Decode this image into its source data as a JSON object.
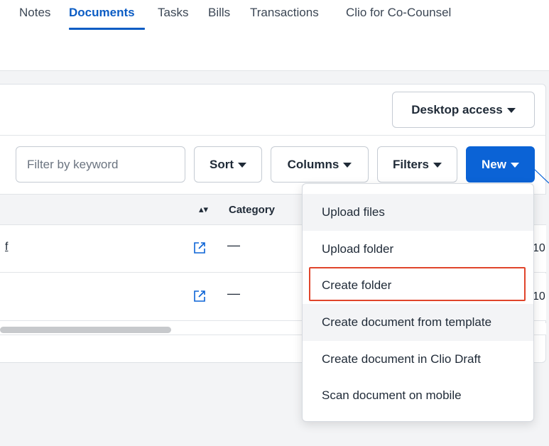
{
  "tabs": [
    {
      "label": "Notes",
      "active": false
    },
    {
      "label": "Documents",
      "active": true
    },
    {
      "label": "Tasks",
      "active": false
    },
    {
      "label": "Bills",
      "active": false
    },
    {
      "label": "Transactions",
      "active": false
    },
    {
      "label": "Clio for Co-Counsel",
      "active": false
    }
  ],
  "toolbar": {
    "desktop_access_label": "Desktop access",
    "filter_placeholder": "Filter by keyword",
    "sort_label": "Sort",
    "columns_label": "Columns",
    "filters_label": "Filters",
    "new_label": "New"
  },
  "table": {
    "columns": [
      "Category"
    ],
    "rows": [
      {
        "name": "f",
        "category": "—",
        "date": "10"
      },
      {
        "name": "",
        "category": "—",
        "date": "10"
      }
    ]
  },
  "new_menu": {
    "items": [
      "Upload files",
      "Upload folder",
      "Create folder",
      "Create document from template",
      "Create document in Clio Draft",
      "Scan document on mobile"
    ],
    "highlighted_item": "Create folder"
  },
  "colors": {
    "accent": "#0b5cc4",
    "primary_button": "#0b63d6",
    "highlight_border": "#e0452b"
  },
  "icons": [
    "external-link-icon",
    "sort-icon",
    "caret-down-icon"
  ]
}
